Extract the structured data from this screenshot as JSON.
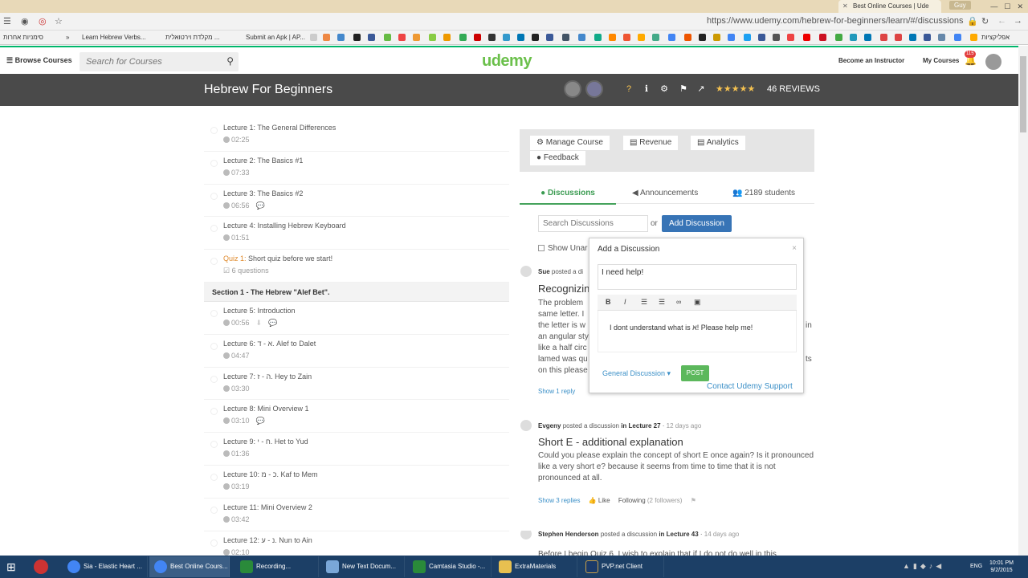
{
  "browser": {
    "tab_title": "Best Online Courses | Ude",
    "user_badge": "Guy",
    "url": "https://www.udemy.com/hebrew-for-beginners/learn/#/discussions",
    "bookmarks": [
      "סימניות אחרות",
      "»",
      "Learn Hebrew Verbs...",
      "מקלדת וירטואלית ...",
      "Submit an Apk | AP...",
      "אפליקציות"
    ]
  },
  "udemy_header": {
    "browse_label": "Browse Courses",
    "search_placeholder": "Search for Courses",
    "logo": "udemy",
    "become_instructor": "Become an Instructor",
    "my_courses": "My Courses",
    "notification_count": "115"
  },
  "course_bar": {
    "title": "Hebrew For Beginners",
    "stars": "★★★★★",
    "reviews": "46 REVIEWS"
  },
  "lectures": [
    {
      "title": "Lecture 1: The General Differences",
      "duration": "02:25"
    },
    {
      "title": "Lecture 2: The Basics #1",
      "duration": "07:33"
    },
    {
      "title": "Lecture 3: The Basics #2",
      "duration": "06:56"
    },
    {
      "title": "Lecture 4: Installing Hebrew Keyboard",
      "duration": "01:51"
    }
  ],
  "quiz": {
    "label": "Quiz 1:",
    "title": "Short quiz before we start!",
    "questions": "6 questions"
  },
  "section": "Section 1 - The Hebrew \"Alef Bet\".",
  "lectures2": [
    {
      "title": "Lecture 5: Introduction",
      "duration": "00:56"
    },
    {
      "title": "Lecture 6: א - ד. Alef to Dalet",
      "duration": "04:47"
    },
    {
      "title": "Lecture 7: ה - ז. Hey to Zain",
      "duration": "03:30"
    },
    {
      "title": "Lecture 8: Mini Overview 1",
      "duration": "03:10"
    },
    {
      "title": "Lecture 9: ח - י. Het to Yud",
      "duration": "01:36"
    },
    {
      "title": "Lecture 10: כ - מ. Kaf to Mem",
      "duration": "03:19"
    },
    {
      "title": "Lecture 11: Mini Overview 2",
      "duration": "03:42"
    },
    {
      "title": "Lecture 12: נ - ע. Nun to Ain",
      "duration": "02:10"
    }
  ],
  "toolbox": {
    "manage": "Manage Course",
    "revenue": "Revenue",
    "analytics": "Analytics",
    "feedback": "Feedback"
  },
  "tabs": {
    "discussions": "Discussions",
    "announcements": "Announcements",
    "students": "2189 students"
  },
  "discussion_controls": {
    "search_placeholder": "Search Discussions",
    "or": "or",
    "add_button": "Add Discussion",
    "show_unanswered": "Show Unar"
  },
  "posts": [
    {
      "author": "Sue",
      "action": "posted a di",
      "title": "Recognizin",
      "body_lines": [
        "The problem",
        "same letter. I",
        "the letter is w",
        "an angular sty",
        "like a half circ",
        "lamed was qu",
        "on this please"
      ],
      "right_fragments": [
        "in",
        "ts"
      ],
      "footer": "Show 1 reply"
    },
    {
      "author": "Evgeny",
      "action": "posted a discussion",
      "location": "in Lecture 27",
      "ago": "12 days ago",
      "title": "Short E - additional explanation",
      "body": "Could you please explain the concept of short E once again? Is it pronounced like a very short e? because it seems from time to time that it is not pronounced at all.",
      "replies": "Show 3 replies",
      "like": "Like",
      "following": "Following",
      "followers": "(2 followers)"
    },
    {
      "author": "Stephen Henderson",
      "action": "posted a discussion",
      "location": "in Lecture 43",
      "ago": "14 days ago",
      "body": "Before I begin Quiz 6, I wish to explain that if I do not do well in this"
    }
  ],
  "popup": {
    "title": "Add a Discussion",
    "close": "×",
    "title_value": "I need help!",
    "body_value": "I dont understand what is א! Please help me!",
    "category": "General Discussion ▾",
    "post_button": "POST",
    "contact": "Contact Udemy Support"
  },
  "taskbar": {
    "items": [
      "Sia - Elastic Heart ...",
      "Best Online Cours...",
      "Recording...",
      "New Text Docum...",
      "Camtasia Studio -...",
      "ExtraMaterials",
      "PVP.net Client"
    ],
    "lang": "ENG",
    "time": "10:01 PM",
    "date": "9/2/2015"
  },
  "colors": {
    "udemy_green": "#6bc04b",
    "accent_blue": "#3774b6",
    "course_bar": "#4a4a4a",
    "tab_green": "#3a9b51",
    "post_green": "#5cb85c",
    "taskbar": "#1c3f66"
  }
}
